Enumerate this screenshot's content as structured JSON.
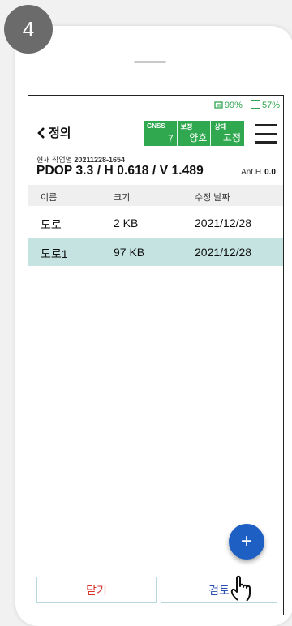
{
  "step": "4",
  "status": {
    "sim_percent": "99%",
    "battery_percent": "57%"
  },
  "header": {
    "back_label": "정의"
  },
  "gnss": {
    "cells": [
      {
        "label": "GNSS",
        "value": "7"
      },
      {
        "label": "보정",
        "value": "양호"
      },
      {
        "label": "상태",
        "value": "고정"
      }
    ],
    "color": "#2fa84f"
  },
  "job": {
    "label": "현재 작업명",
    "name": "20211228-1654"
  },
  "precision": {
    "text": "PDOP 3.3 / H 0.618 / V 1.489",
    "ant_label": "Ant.H",
    "ant_value": "0.0"
  },
  "table": {
    "headers": [
      "이름",
      "크기",
      "수정 날짜"
    ],
    "rows": [
      {
        "name": "도로",
        "size": "2 KB",
        "date": "2021/12/28",
        "selected": false
      },
      {
        "name": "도로1",
        "size": "97 KB",
        "date": "2021/12/28",
        "selected": true
      }
    ],
    "selected_color": "#c4e3e1"
  },
  "fab_label": "+",
  "buttons": {
    "close": "닫기",
    "review": "검토"
  },
  "icons": [
    "chevron-left-icon",
    "sim-card-icon",
    "battery-icon",
    "menu-icon",
    "plus-icon",
    "pointing-hand-icon"
  ]
}
